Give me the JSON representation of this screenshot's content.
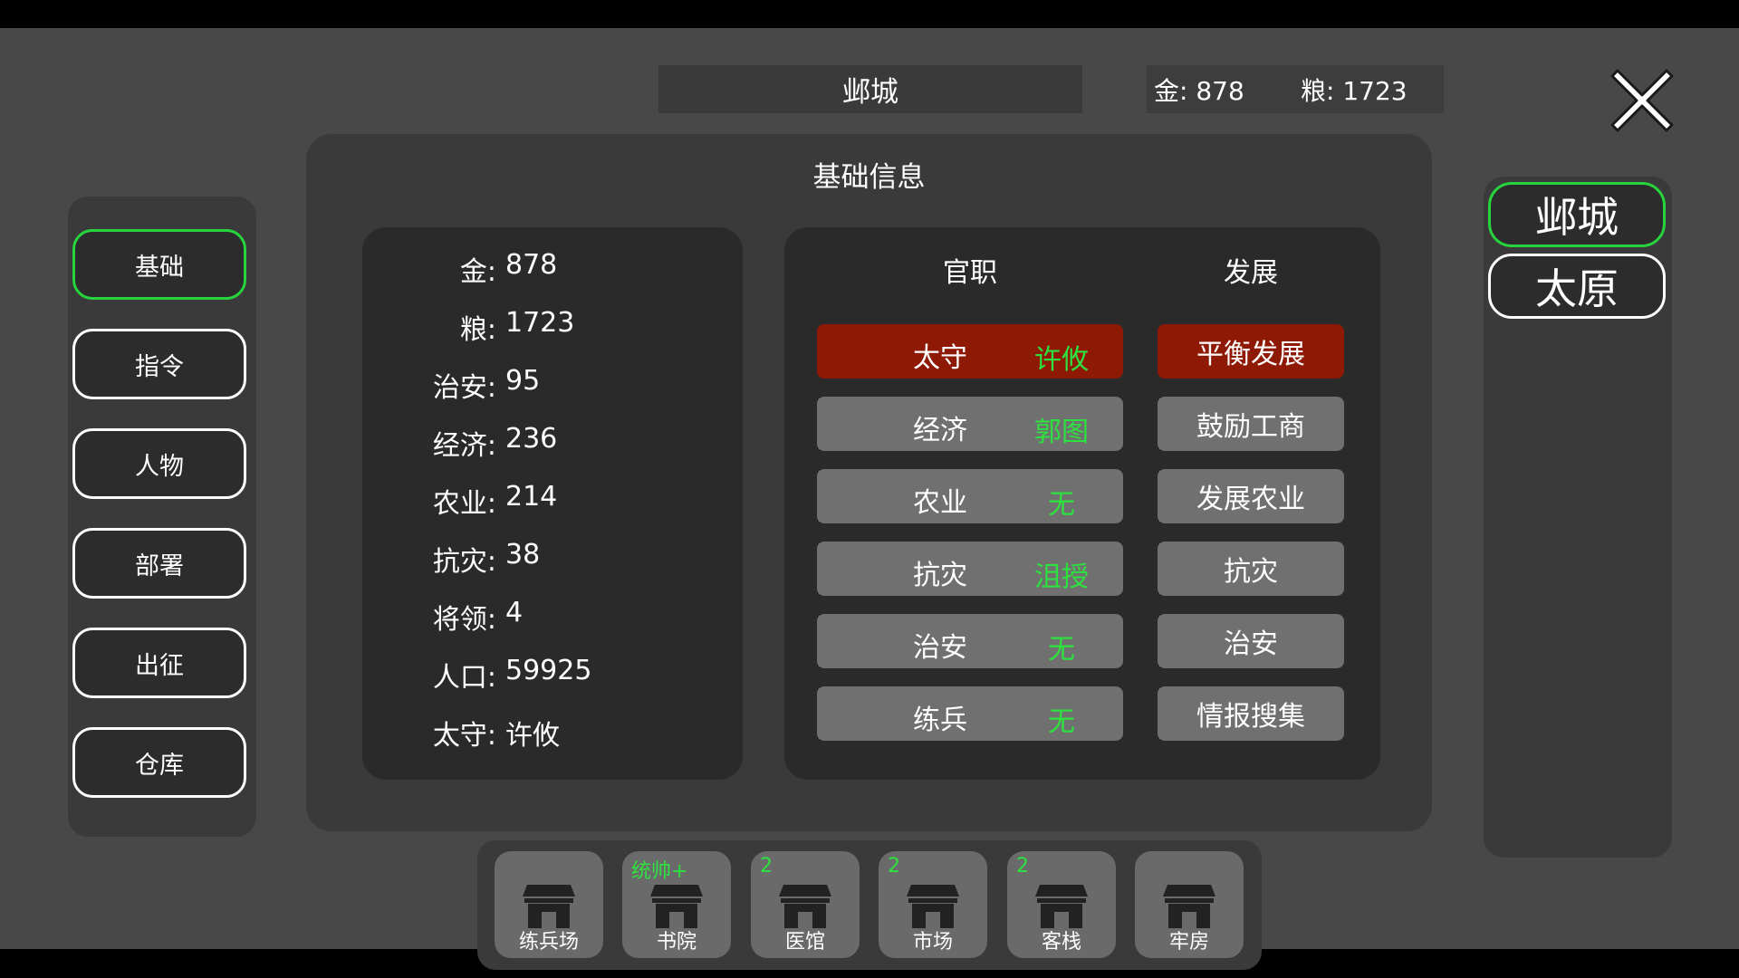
{
  "header": {
    "city_title": "邺城",
    "gold": "金: 878",
    "grain": "粮: 1723"
  },
  "nav": {
    "items": [
      {
        "label": "基础",
        "active": true
      },
      {
        "label": "指令"
      },
      {
        "label": "人物"
      },
      {
        "label": "部署"
      },
      {
        "label": "出征"
      },
      {
        "label": "仓库"
      }
    ]
  },
  "main": {
    "title": "基础信息",
    "stats": [
      {
        "label": "金:",
        "value": "878"
      },
      {
        "label": "粮:",
        "value": "1723"
      },
      {
        "label": "治安:",
        "value": "95"
      },
      {
        "label": "经济:",
        "value": "236"
      },
      {
        "label": "农业:",
        "value": "214"
      },
      {
        "label": "抗灾:",
        "value": "38"
      },
      {
        "label": "将领:",
        "value": "4"
      },
      {
        "label": "人口:",
        "value": "59925"
      },
      {
        "label": "太守:",
        "value": "许攸"
      }
    ],
    "posts_header": "官职",
    "dev_header": "发展",
    "posts": [
      {
        "name": "太守",
        "holder": "许攸"
      },
      {
        "name": "经济",
        "holder": "郭图"
      },
      {
        "name": "农业",
        "holder": "无"
      },
      {
        "name": "抗灾",
        "holder": "沮授"
      },
      {
        "name": "治安",
        "holder": "无"
      },
      {
        "name": "练兵",
        "holder": "无"
      }
    ],
    "development": [
      "平衡发展",
      "鼓励工商",
      "发展农业",
      "抗灾",
      "治安",
      "情报搜集"
    ]
  },
  "cities": [
    "邺城",
    "太原"
  ],
  "buildings": [
    {
      "name": "练兵场",
      "badge": ""
    },
    {
      "name": "书院",
      "badge": "统帅+"
    },
    {
      "name": "医馆",
      "badge": "2"
    },
    {
      "name": "市场",
      "badge": "2"
    },
    {
      "name": "客栈",
      "badge": "2"
    },
    {
      "name": "牢房",
      "badge": ""
    }
  ],
  "colors": {
    "accent_green": "#27d43e",
    "active_red": "#8e1a06",
    "holder_green": "#2de23f"
  },
  "icons": {
    "close": "close-x-icon",
    "building": "shop-building-icon"
  }
}
